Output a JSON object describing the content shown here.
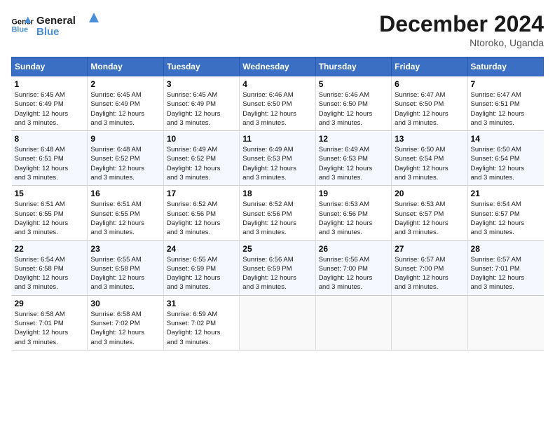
{
  "header": {
    "logo_line1": "General",
    "logo_line2": "Blue",
    "month": "December 2024",
    "location": "Ntoroko, Uganda"
  },
  "weekdays": [
    "Sunday",
    "Monday",
    "Tuesday",
    "Wednesday",
    "Thursday",
    "Friday",
    "Saturday"
  ],
  "weeks": [
    [
      {
        "day": "1",
        "sunrise": "6:45 AM",
        "sunset": "6:49 PM",
        "daylight": "12 hours and 3 minutes."
      },
      {
        "day": "2",
        "sunrise": "6:45 AM",
        "sunset": "6:49 PM",
        "daylight": "12 hours and 3 minutes."
      },
      {
        "day": "3",
        "sunrise": "6:45 AM",
        "sunset": "6:49 PM",
        "daylight": "12 hours and 3 minutes."
      },
      {
        "day": "4",
        "sunrise": "6:46 AM",
        "sunset": "6:50 PM",
        "daylight": "12 hours and 3 minutes."
      },
      {
        "day": "5",
        "sunrise": "6:46 AM",
        "sunset": "6:50 PM",
        "daylight": "12 hours and 3 minutes."
      },
      {
        "day": "6",
        "sunrise": "6:47 AM",
        "sunset": "6:50 PM",
        "daylight": "12 hours and 3 minutes."
      },
      {
        "day": "7",
        "sunrise": "6:47 AM",
        "sunset": "6:51 PM",
        "daylight": "12 hours and 3 minutes."
      }
    ],
    [
      {
        "day": "8",
        "sunrise": "6:48 AM",
        "sunset": "6:51 PM",
        "daylight": "12 hours and 3 minutes."
      },
      {
        "day": "9",
        "sunrise": "6:48 AM",
        "sunset": "6:52 PM",
        "daylight": "12 hours and 3 minutes."
      },
      {
        "day": "10",
        "sunrise": "6:49 AM",
        "sunset": "6:52 PM",
        "daylight": "12 hours and 3 minutes."
      },
      {
        "day": "11",
        "sunrise": "6:49 AM",
        "sunset": "6:53 PM",
        "daylight": "12 hours and 3 minutes."
      },
      {
        "day": "12",
        "sunrise": "6:49 AM",
        "sunset": "6:53 PM",
        "daylight": "12 hours and 3 minutes."
      },
      {
        "day": "13",
        "sunrise": "6:50 AM",
        "sunset": "6:54 PM",
        "daylight": "12 hours and 3 minutes."
      },
      {
        "day": "14",
        "sunrise": "6:50 AM",
        "sunset": "6:54 PM",
        "daylight": "12 hours and 3 minutes."
      }
    ],
    [
      {
        "day": "15",
        "sunrise": "6:51 AM",
        "sunset": "6:55 PM",
        "daylight": "12 hours and 3 minutes."
      },
      {
        "day": "16",
        "sunrise": "6:51 AM",
        "sunset": "6:55 PM",
        "daylight": "12 hours and 3 minutes."
      },
      {
        "day": "17",
        "sunrise": "6:52 AM",
        "sunset": "6:56 PM",
        "daylight": "12 hours and 3 minutes."
      },
      {
        "day": "18",
        "sunrise": "6:52 AM",
        "sunset": "6:56 PM",
        "daylight": "12 hours and 3 minutes."
      },
      {
        "day": "19",
        "sunrise": "6:53 AM",
        "sunset": "6:56 PM",
        "daylight": "12 hours and 3 minutes."
      },
      {
        "day": "20",
        "sunrise": "6:53 AM",
        "sunset": "6:57 PM",
        "daylight": "12 hours and 3 minutes."
      },
      {
        "day": "21",
        "sunrise": "6:54 AM",
        "sunset": "6:57 PM",
        "daylight": "12 hours and 3 minutes."
      }
    ],
    [
      {
        "day": "22",
        "sunrise": "6:54 AM",
        "sunset": "6:58 PM",
        "daylight": "12 hours and 3 minutes."
      },
      {
        "day": "23",
        "sunrise": "6:55 AM",
        "sunset": "6:58 PM",
        "daylight": "12 hours and 3 minutes."
      },
      {
        "day": "24",
        "sunrise": "6:55 AM",
        "sunset": "6:59 PM",
        "daylight": "12 hours and 3 minutes."
      },
      {
        "day": "25",
        "sunrise": "6:56 AM",
        "sunset": "6:59 PM",
        "daylight": "12 hours and 3 minutes."
      },
      {
        "day": "26",
        "sunrise": "6:56 AM",
        "sunset": "7:00 PM",
        "daylight": "12 hours and 3 minutes."
      },
      {
        "day": "27",
        "sunrise": "6:57 AM",
        "sunset": "7:00 PM",
        "daylight": "12 hours and 3 minutes."
      },
      {
        "day": "28",
        "sunrise": "6:57 AM",
        "sunset": "7:01 PM",
        "daylight": "12 hours and 3 minutes."
      }
    ],
    [
      {
        "day": "29",
        "sunrise": "6:58 AM",
        "sunset": "7:01 PM",
        "daylight": "12 hours and 3 minutes."
      },
      {
        "day": "30",
        "sunrise": "6:58 AM",
        "sunset": "7:02 PM",
        "daylight": "12 hours and 3 minutes."
      },
      {
        "day": "31",
        "sunrise": "6:59 AM",
        "sunset": "7:02 PM",
        "daylight": "12 hours and 3 minutes."
      },
      null,
      null,
      null,
      null
    ]
  ],
  "labels": {
    "sunrise": "Sunrise:",
    "sunset": "Sunset:",
    "daylight": "Daylight:"
  }
}
